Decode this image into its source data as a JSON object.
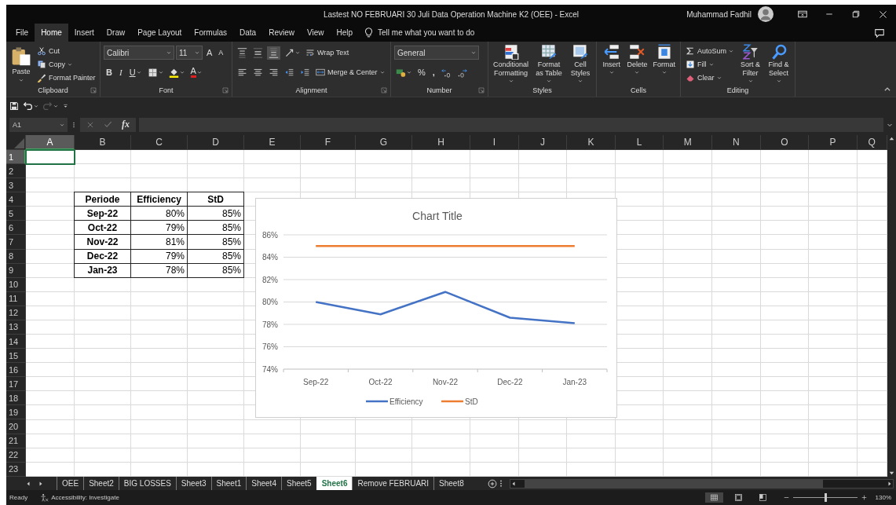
{
  "window": {
    "title": "Lastest NO FEBRUARI 30 Juli Data Operation Machine K2 (OEE)  -  Excel",
    "user": "Muhammad Fadhil"
  },
  "menu_tabs": [
    {
      "label": "File",
      "selected": false
    },
    {
      "label": "Home",
      "selected": true
    },
    {
      "label": "Insert",
      "selected": false
    },
    {
      "label": "Draw",
      "selected": false
    },
    {
      "label": "Page Layout",
      "selected": false
    },
    {
      "label": "Formulas",
      "selected": false
    },
    {
      "label": "Data",
      "selected": false
    },
    {
      "label": "Review",
      "selected": false
    },
    {
      "label": "View",
      "selected": false
    },
    {
      "label": "Help",
      "selected": false
    }
  ],
  "tell_me": {
    "placeholder": "Tell me what you want to do"
  },
  "ribbon": {
    "clipboard": {
      "label": "Clipboard",
      "paste": "Paste",
      "cut": "Cut",
      "copy": "Copy",
      "format_painter": "Format Painter"
    },
    "font": {
      "label": "Font",
      "font_name": "Calibri",
      "font_size": "11",
      "grow": "A",
      "shrink": "A",
      "bold": "B",
      "italic": "I",
      "underline": "U",
      "font_color": "A"
    },
    "alignment": {
      "label": "Alignment",
      "wrap_text": "Wrap Text",
      "merge_center": "Merge & Center"
    },
    "number": {
      "label": "Number",
      "format": "General",
      "percent": "%",
      "comma": ","
    },
    "styles": {
      "label": "Styles",
      "conditional_formatting": "Conditional Formatting",
      "format_as_table": "Format as Table",
      "cell_styles": "Cell Styles"
    },
    "cells": {
      "label": "Cells",
      "insert": "Insert",
      "delete": "Delete",
      "format": "Format"
    },
    "editing": {
      "label": "Editing",
      "autosum": "AutoSum",
      "fill": "Fill",
      "clear": "Clear",
      "sort_filter": "Sort & Filter",
      "find_select": "Find & Select"
    }
  },
  "quick_access": {
    "redo": {
      "disabled": true
    }
  },
  "formula_bar": {
    "name_box": "A1",
    "function_label": "fx",
    "entry_disabled": true
  },
  "sheet": {
    "columns": [
      {
        "label": "A",
        "selected": true
      },
      {
        "label": "B",
        "selected": false
      },
      {
        "label": "C",
        "selected": false
      },
      {
        "label": "D",
        "selected": false
      },
      {
        "label": "E",
        "selected": false
      },
      {
        "label": "F",
        "selected": false
      },
      {
        "label": "G",
        "selected": false
      },
      {
        "label": "H",
        "selected": false
      },
      {
        "label": "I",
        "selected": false
      },
      {
        "label": "J",
        "selected": false
      },
      {
        "label": "K",
        "selected": false
      },
      {
        "label": "L",
        "selected": false
      },
      {
        "label": "M",
        "selected": false
      },
      {
        "label": "N",
        "selected": false
      },
      {
        "label": "O",
        "selected": false
      },
      {
        "label": "P",
        "selected": false
      },
      {
        "label": "Q",
        "selected": false
      }
    ],
    "rows": [
      {
        "label": "1",
        "selected": true
      },
      {
        "label": "2",
        "selected": false
      },
      {
        "label": "3",
        "selected": false
      },
      {
        "label": "4",
        "selected": false
      },
      {
        "label": "5",
        "selected": false
      },
      {
        "label": "6",
        "selected": false
      },
      {
        "label": "7",
        "selected": false
      },
      {
        "label": "8",
        "selected": false
      },
      {
        "label": "9",
        "selected": false
      },
      {
        "label": "10",
        "selected": false
      },
      {
        "label": "11",
        "selected": false
      },
      {
        "label": "12",
        "selected": false
      },
      {
        "label": "13",
        "selected": false
      },
      {
        "label": "14",
        "selected": false
      },
      {
        "label": "15",
        "selected": false
      },
      {
        "label": "16",
        "selected": false
      },
      {
        "label": "17",
        "selected": false
      },
      {
        "label": "18",
        "selected": false
      },
      {
        "label": "19",
        "selected": false
      },
      {
        "label": "20",
        "selected": false
      },
      {
        "label": "21",
        "selected": false
      },
      {
        "label": "22",
        "selected": false
      },
      {
        "label": "23",
        "selected": false
      }
    ],
    "table": {
      "header": [
        "Periode",
        "Efficiency",
        "StD"
      ],
      "rows": [
        [
          "Sep-22",
          "80%",
          "85%"
        ],
        [
          "Oct-22",
          "79%",
          "85%"
        ],
        [
          "Nov-22",
          "81%",
          "85%"
        ],
        [
          "Dec-22",
          "79%",
          "85%"
        ],
        [
          "Jan-23",
          "78%",
          "85%"
        ]
      ]
    }
  },
  "chart": {
    "chart_data": {
      "type": "line",
      "title": "Chart Title",
      "categories": [
        "Sep-22",
        "Oct-22",
        "Nov-22",
        "Dec-22",
        "Jan-23"
      ],
      "series": [
        {
          "name": "Efficiency",
          "color": "#4472c4",
          "values": [
            80.0,
            78.9,
            80.9,
            78.6,
            78.1
          ]
        },
        {
          "name": "StD",
          "color": "#ed7d31",
          "values": [
            85,
            85,
            85,
            85,
            85
          ]
        }
      ],
      "ylim": [
        74,
        86
      ],
      "yticks": [
        {
          "value": 74,
          "label": "74%"
        },
        {
          "value": 76,
          "label": "76%"
        },
        {
          "value": 78,
          "label": "78%"
        },
        {
          "value": 80,
          "label": "80%"
        },
        {
          "value": 82,
          "label": "82%"
        },
        {
          "value": 84,
          "label": "84%"
        },
        {
          "value": 86,
          "label": "86%"
        }
      ],
      "grid": true,
      "legend": true
    }
  },
  "sheet_tabs": [
    {
      "label": "OEE",
      "selected": false
    },
    {
      "label": "Sheet2",
      "selected": false
    },
    {
      "label": "BIG LOSSES",
      "selected": false
    },
    {
      "label": "Sheet3",
      "selected": false
    },
    {
      "label": "Sheet1",
      "selected": false
    },
    {
      "label": "Sheet4",
      "selected": false
    },
    {
      "label": "Sheet5",
      "selected": false
    },
    {
      "label": "Sheet6",
      "selected": true
    },
    {
      "label": "Remove FEBRUARI",
      "selected": false
    },
    {
      "label": "Sheet8",
      "selected": false
    }
  ],
  "status_bar": {
    "status": "Ready",
    "accessibility": "Accessibility: Investigate",
    "views": [
      {
        "kind": "normal",
        "selected": true
      },
      {
        "kind": "page_layout",
        "selected": false
      },
      {
        "kind": "page_break",
        "selected": false
      }
    ],
    "zoom": {
      "level": 0.5,
      "reading": "130%"
    }
  }
}
